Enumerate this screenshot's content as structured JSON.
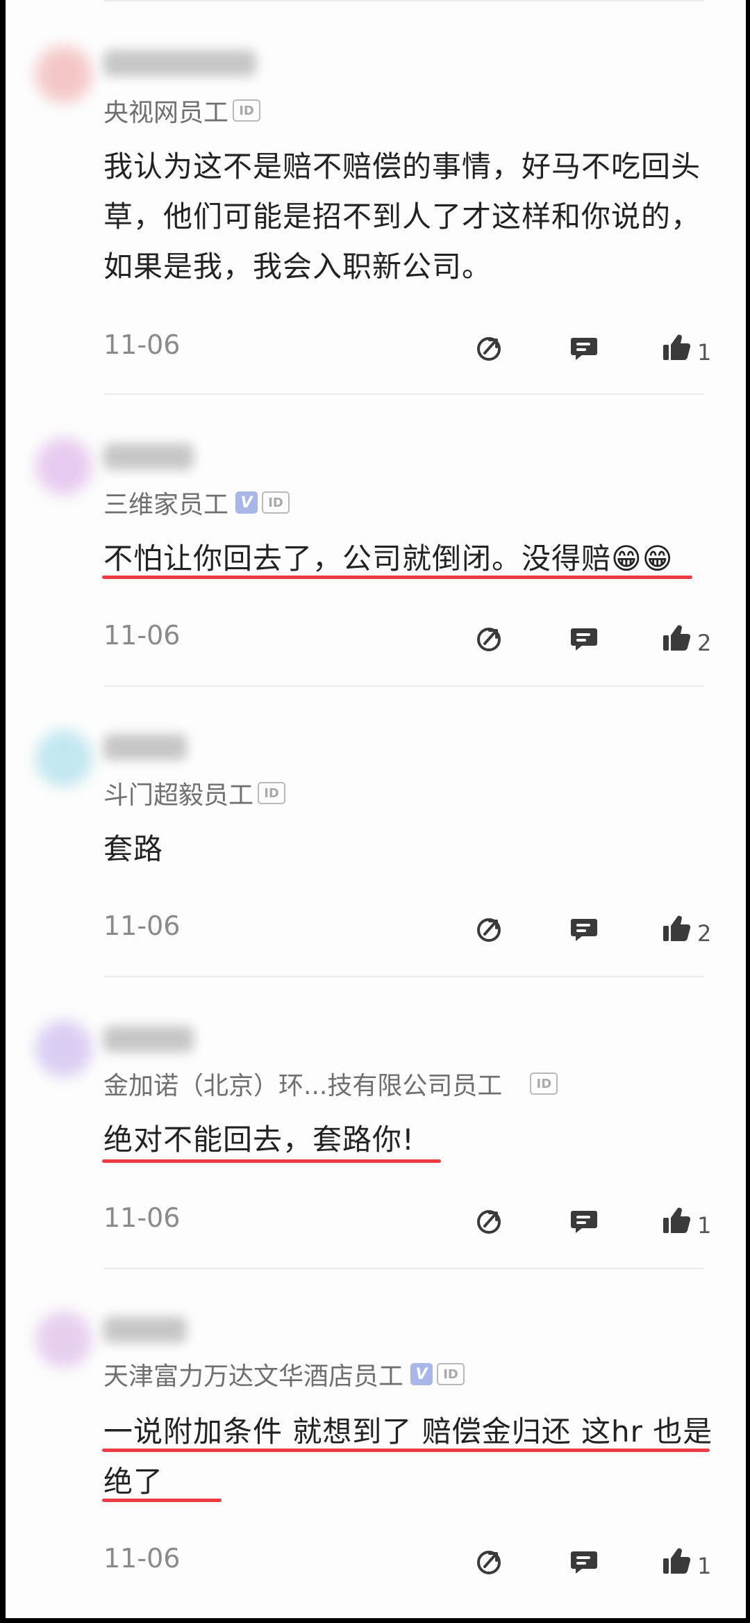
{
  "colors": {
    "underline": "#ef3b44",
    "verified_badge": "#a9b6e8",
    "icon": "#3a3a3a"
  },
  "comments": [
    {
      "avatar_color": "#f4c5c5",
      "company": "央视网员工",
      "verified": false,
      "text": "我认为这不是赔不赔偿的事情，好马不吃回头草，他们可能是招不到人了才这样和你说的，如果是我，我会入职新公司。",
      "date": "11-06",
      "likes": "1"
    },
    {
      "avatar_color": "#e7c9ef",
      "company": "三维家员工",
      "verified": true,
      "text": "不怕让你回去了，公司就倒闭。没得赔😁😁",
      "date": "11-06",
      "likes": "2"
    },
    {
      "avatar_color": "#bfe6ef",
      "company": "斗门超毅员工",
      "verified": false,
      "text": "套路",
      "date": "11-06",
      "likes": "2"
    },
    {
      "avatar_color": "#d9ccf2",
      "company": "金加诺（北京）环...技有限公司员工",
      "verified": false,
      "text": "绝对不能回去，套路你!",
      "date": "11-06",
      "likes": "1"
    },
    {
      "avatar_color": "#e6cdef",
      "company": "天津富力万达文华酒店员工",
      "verified": true,
      "text": "一说附加条件 就想到了 赔偿金归还 这hr 也是绝了",
      "date": "11-06",
      "likes": "1"
    }
  ],
  "icons": {
    "share": "share-icon",
    "reply": "comment-icon",
    "like": "thumbs-up-icon"
  },
  "badges": {
    "id": "ID",
    "verified": "V"
  }
}
